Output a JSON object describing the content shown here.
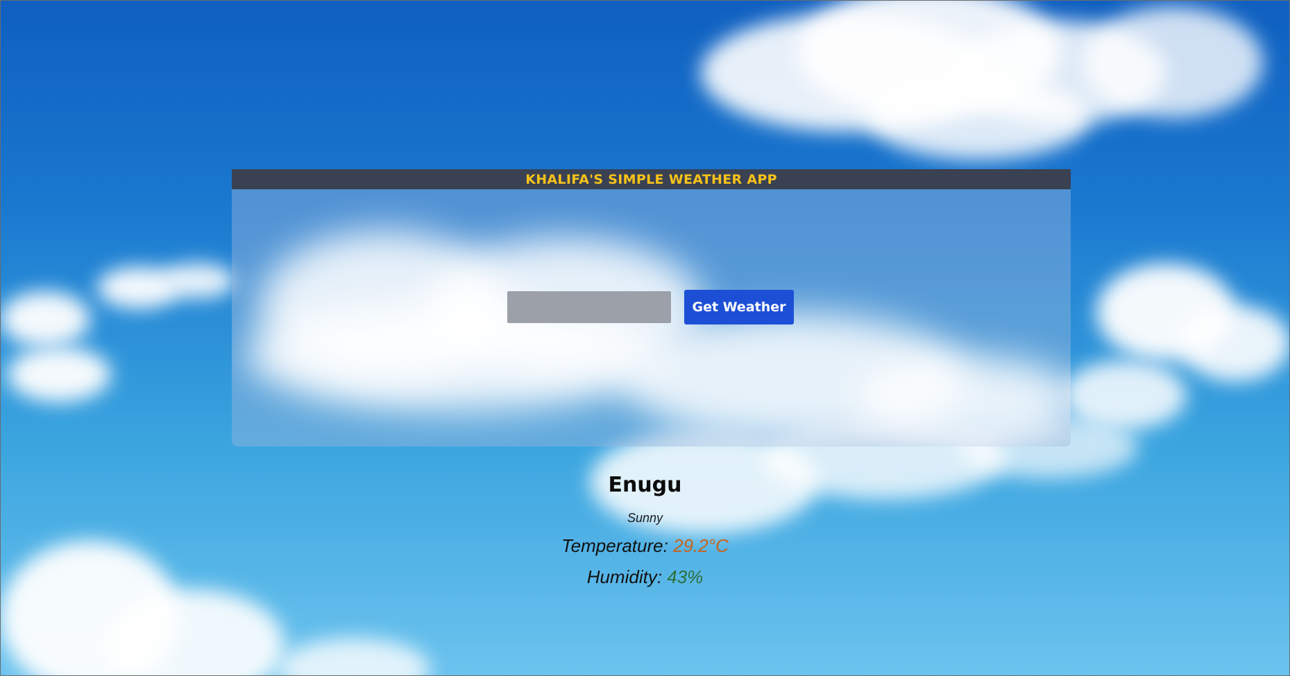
{
  "app": {
    "title": "KHALIFA'S SIMPLE WEATHER APP"
  },
  "search": {
    "value": "",
    "placeholder": "",
    "button_label": "Get Weather"
  },
  "weather": {
    "city": "Enugu",
    "description": "Sunny",
    "temperature_label": "Temperature: ",
    "temperature_value": "29.2°C",
    "humidity_label": "Humidity: ",
    "humidity_value": "43%"
  },
  "colors": {
    "header_bg": "#3a4152",
    "title_text": "#f7c31a",
    "button_bg": "#1d4fd6",
    "input_bg": "#9ca0a9",
    "temperature_value": "#c6631d",
    "humidity_value": "#2d6e3a"
  }
}
